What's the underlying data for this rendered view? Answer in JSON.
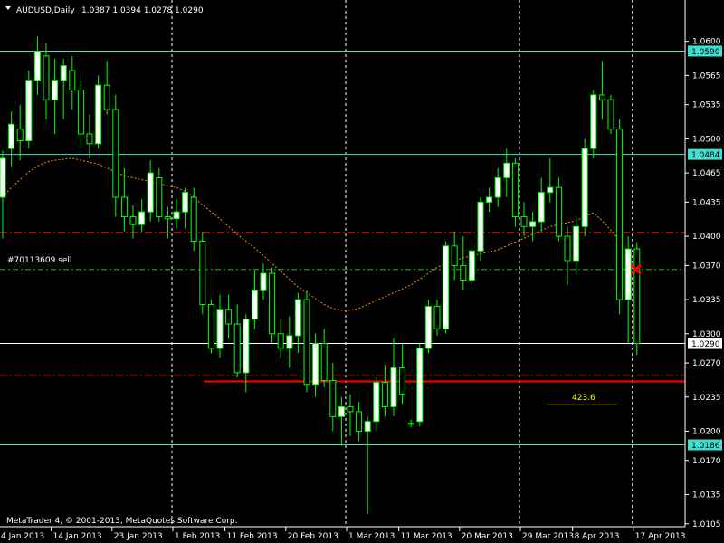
{
  "header": {
    "symbol": "AUDUSD,Daily",
    "ohlc": "1.0387 1.0394 1.0278 1.0290"
  },
  "order_label": "#70113609 sell",
  "fib_label": "423.6",
  "copyright": "MetaTrader 4, © 2001-2013, MetaQuotes Software Corp.",
  "colors": {
    "background": "#000000",
    "bull_candle": "#ffffff",
    "bear_candle": "#000000",
    "wick": "#00ff00",
    "hline": "#40e0d0",
    "support_line": "#ff0000",
    "ma_line": "#ff8c00",
    "fib_label": "#ffff00",
    "sell_marker": "#ff0000"
  },
  "chart_data": {
    "type": "candlestick",
    "title": "AUDUSD,Daily",
    "ylim": [
      1.0102,
      1.0622
    ],
    "y_ticks": [
      "1.0600",
      "1.0565",
      "1.0535",
      "1.0500",
      "1.0465",
      "1.0435",
      "1.0400",
      "1.0370",
      "1.0335",
      "1.0300",
      "1.0270",
      "1.0235",
      "1.0200",
      "1.0170",
      "1.0135",
      "1.0105"
    ],
    "x_ticks": [
      {
        "label": "4 Jan 2013",
        "index": 0
      },
      {
        "label": "14 Jan 2013",
        "index": 6
      },
      {
        "label": "23 Jan 2013",
        "index": 13
      },
      {
        "label": "1 Feb 2013",
        "index": 20
      },
      {
        "label": "11 Feb 2013",
        "index": 26
      },
      {
        "label": "20 Feb 2013",
        "index": 33
      },
      {
        "label": "1 Mar 2013",
        "index": 40
      },
      {
        "label": "11 Mar 2013",
        "index": 46
      },
      {
        "label": "20 Mar 2013",
        "index": 53
      },
      {
        "label": "29 Mar 2013",
        "index": 60
      },
      {
        "label": "8 Apr 2013",
        "index": 66
      },
      {
        "label": "17 Apr 2013",
        "index": 73
      }
    ],
    "candles": [
      {
        "date": "4 Jan 2013",
        "o": 1.044,
        "h": 1.0488,
        "l": 1.0398,
        "c": 1.048
      },
      {
        "date": "7 Jan 2013",
        "o": 1.049,
        "h": 1.0528,
        "l": 1.0472,
        "c": 1.0515
      },
      {
        "date": "8 Jan 2013",
        "o": 1.051,
        "h": 1.0535,
        "l": 1.0478,
        "c": 1.0498
      },
      {
        "date": "9 Jan 2013",
        "o": 1.0498,
        "h": 1.057,
        "l": 1.049,
        "c": 1.056
      },
      {
        "date": "10 Jan 2013",
        "o": 1.056,
        "h": 1.0605,
        "l": 1.0545,
        "c": 1.059
      },
      {
        "date": "11 Jan 2013",
        "o": 1.0585,
        "h": 1.0598,
        "l": 1.052,
        "c": 1.054
      },
      {
        "date": "14 Jan 2013",
        "o": 1.054,
        "h": 1.0582,
        "l": 1.0505,
        "c": 1.056
      },
      {
        "date": "15 Jan 2013",
        "o": 1.056,
        "h": 1.0582,
        "l": 1.052,
        "c": 1.0575
      },
      {
        "date": "16 Jan 2013",
        "o": 1.057,
        "h": 1.0585,
        "l": 1.053,
        "c": 1.055
      },
      {
        "date": "17 Jan 2013",
        "o": 1.055,
        "h": 1.056,
        "l": 1.049,
        "c": 1.0505
      },
      {
        "date": "18 Jan 2013",
        "o": 1.0505,
        "h": 1.0525,
        "l": 1.048,
        "c": 1.0495
      },
      {
        "date": "21 Jan 2013",
        "o": 1.0495,
        "h": 1.0565,
        "l": 1.049,
        "c": 1.0555
      },
      {
        "date": "22 Jan 2013",
        "o": 1.0555,
        "h": 1.058,
        "l": 1.0525,
        "c": 1.053
      },
      {
        "date": "23 Jan 2013",
        "o": 1.053,
        "h": 1.0545,
        "l": 1.042,
        "c": 1.044
      },
      {
        "date": "24 Jan 2013",
        "o": 1.044,
        "h": 1.047,
        "l": 1.0405,
        "c": 1.042
      },
      {
        "date": "25 Jan 2013",
        "o": 1.042,
        "h": 1.0432,
        "l": 1.0398,
        "c": 1.0412
      },
      {
        "date": "28 Jan 2013",
        "o": 1.0412,
        "h": 1.0438,
        "l": 1.0405,
        "c": 1.0425
      },
      {
        "date": "29 Jan 2013",
        "o": 1.0425,
        "h": 1.0478,
        "l": 1.0415,
        "c": 1.0465
      },
      {
        "date": "30 Jan 2013",
        "o": 1.046,
        "h": 1.047,
        "l": 1.0415,
        "c": 1.042
      },
      {
        "date": "31 Jan 2013",
        "o": 1.042,
        "h": 1.043,
        "l": 1.0398,
        "c": 1.0418
      },
      {
        "date": "1 Feb 2013",
        "o": 1.0418,
        "h": 1.0438,
        "l": 1.0408,
        "c": 1.0425
      },
      {
        "date": "4 Feb 2013",
        "o": 1.0425,
        "h": 1.045,
        "l": 1.0408,
        "c": 1.0445
      },
      {
        "date": "5 Feb 2013",
        "o": 1.044,
        "h": 1.045,
        "l": 1.0385,
        "c": 1.0395
      },
      {
        "date": "6 Feb 2013",
        "o": 1.0395,
        "h": 1.0405,
        "l": 1.032,
        "c": 1.033
      },
      {
        "date": "7 Feb 2013",
        "o": 1.033,
        "h": 1.0335,
        "l": 1.028,
        "c": 1.0285
      },
      {
        "date": "8 Feb 2013",
        "o": 1.0285,
        "h": 1.034,
        "l": 1.0275,
        "c": 1.0325
      },
      {
        "date": "11 Feb 2013",
        "o": 1.0325,
        "h": 1.034,
        "l": 1.0295,
        "c": 1.031
      },
      {
        "date": "12 Feb 2013",
        "o": 1.031,
        "h": 1.033,
        "l": 1.0255,
        "c": 1.026
      },
      {
        "date": "13 Feb 2013",
        "o": 1.026,
        "h": 1.032,
        "l": 1.024,
        "c": 1.0315
      },
      {
        "date": "14 Feb 2013",
        "o": 1.0315,
        "h": 1.0365,
        "l": 1.0305,
        "c": 1.0345
      },
      {
        "date": "15 Feb 2013",
        "o": 1.0345,
        "h": 1.0372,
        "l": 1.0335,
        "c": 1.0362
      },
      {
        "date": "18 Feb 2013",
        "o": 1.0362,
        "h": 1.0368,
        "l": 1.029,
        "c": 1.03
      },
      {
        "date": "19 Feb 2013",
        "o": 1.03,
        "h": 1.0315,
        "l": 1.0275,
        "c": 1.0285
      },
      {
        "date": "20 Feb 2013",
        "o": 1.0285,
        "h": 1.0318,
        "l": 1.0265,
        "c": 1.0298
      },
      {
        "date": "21 Feb 2013",
        "o": 1.0298,
        "h": 1.0342,
        "l": 1.028,
        "c": 1.0335
      },
      {
        "date": "22 Feb 2013",
        "o": 1.0335,
        "h": 1.0345,
        "l": 1.024,
        "c": 1.0248
      },
      {
        "date": "25 Feb 2013",
        "o": 1.0248,
        "h": 1.03,
        "l": 1.0235,
        "c": 1.029
      },
      {
        "date": "26 Feb 2013",
        "o": 1.029,
        "h": 1.0305,
        "l": 1.0245,
        "c": 1.0252
      },
      {
        "date": "27 Feb 2013",
        "o": 1.0252,
        "h": 1.027,
        "l": 1.02,
        "c": 1.0215
      },
      {
        "date": "28 Feb 2013",
        "o": 1.0215,
        "h": 1.0235,
        "l": 1.0185,
        "c": 1.0225
      },
      {
        "date": "1 Mar 2013",
        "o": 1.0225,
        "h": 1.0238,
        "l": 1.0195,
        "c": 1.022
      },
      {
        "date": "4 Mar 2013",
        "o": 1.022,
        "h": 1.023,
        "l": 1.019,
        "c": 1.02
      },
      {
        "date": "5 Mar 2013",
        "o": 1.02,
        "h": 1.0215,
        "l": 1.0115,
        "c": 1.021
      },
      {
        "date": "6 Mar 2013",
        "o": 1.021,
        "h": 1.0255,
        "l": 1.02,
        "c": 1.025
      },
      {
        "date": "7 Mar 2013",
        "o": 1.025,
        "h": 1.0268,
        "l": 1.0215,
        "c": 1.0225
      },
      {
        "date": "8 Mar 2013",
        "o": 1.0225,
        "h": 1.0295,
        "l": 1.0215,
        "c": 1.0265
      },
      {
        "date": "11 Mar 2013",
        "o": 1.0265,
        "h": 1.029,
        "l": 1.0228,
        "c": 1.0238
      },
      {
        "date": "12 Mar 2013",
        "o": 1.0208,
        "h": 1.0212,
        "l": 1.0204,
        "c": 1.0208
      },
      {
        "date": "13 Mar 2013",
        "o": 1.021,
        "h": 1.029,
        "l": 1.0205,
        "c": 1.0285
      },
      {
        "date": "14 Mar 2013",
        "o": 1.0285,
        "h": 1.0335,
        "l": 1.028,
        "c": 1.0328
      },
      {
        "date": "15 Mar 2013",
        "o": 1.0328,
        "h": 1.0335,
        "l": 1.0298,
        "c": 1.0305
      },
      {
        "date": "18 Mar 2013",
        "o": 1.0305,
        "h": 1.0395,
        "l": 1.03,
        "c": 1.039
      },
      {
        "date": "19 Mar 2013",
        "o": 1.039,
        "h": 1.0405,
        "l": 1.0355,
        "c": 1.037
      },
      {
        "date": "20 Mar 2013",
        "o": 1.037,
        "h": 1.04,
        "l": 1.0345,
        "c": 1.0355
      },
      {
        "date": "21 Mar 2013",
        "o": 1.0355,
        "h": 1.0388,
        "l": 1.035,
        "c": 1.0385
      },
      {
        "date": "22 Mar 2013",
        "o": 1.0385,
        "h": 1.044,
        "l": 1.0375,
        "c": 1.0435
      },
      {
        "date": "25 Mar 2013",
        "o": 1.0435,
        "h": 1.045,
        "l": 1.0425,
        "c": 1.044
      },
      {
        "date": "26 Mar 2013",
        "o": 1.044,
        "h": 1.047,
        "l": 1.043,
        "c": 1.046
      },
      {
        "date": "27 Mar 2013",
        "o": 1.046,
        "h": 1.049,
        "l": 1.044,
        "c": 1.0475
      },
      {
        "date": "28 Mar 2013",
        "o": 1.0475,
        "h": 1.048,
        "l": 1.041,
        "c": 1.042
      },
      {
        "date": "29 Mar 2013",
        "o": 1.042,
        "h": 1.0435,
        "l": 1.04,
        "c": 1.041
      },
      {
        "date": "1 Apr 2013",
        "o": 1.041,
        "h": 1.0425,
        "l": 1.0395,
        "c": 1.0415
      },
      {
        "date": "2 Apr 2013",
        "o": 1.0415,
        "h": 1.046,
        "l": 1.0405,
        "c": 1.0445
      },
      {
        "date": "3 Apr 2013",
        "o": 1.0445,
        "h": 1.048,
        "l": 1.0435,
        "c": 1.045
      },
      {
        "date": "4 Apr 2013",
        "o": 1.045,
        "h": 1.046,
        "l": 1.0395,
        "c": 1.04
      },
      {
        "date": "5 Apr 2013",
        "o": 1.04,
        "h": 1.041,
        "l": 1.035,
        "c": 1.0375
      },
      {
        "date": "8 Apr 2013",
        "o": 1.0375,
        "h": 1.042,
        "l": 1.036,
        "c": 1.041
      },
      {
        "date": "9 Apr 2013",
        "o": 1.041,
        "h": 1.05,
        "l": 1.04,
        "c": 1.049
      },
      {
        "date": "10 Apr 2013",
        "o": 1.049,
        "h": 1.055,
        "l": 1.048,
        "c": 1.0545
      },
      {
        "date": "11 Apr 2013",
        "o": 1.0545,
        "h": 1.058,
        "l": 1.052,
        "c": 1.054
      },
      {
        "date": "12 Apr 2013",
        "o": 1.054,
        "h": 1.0545,
        "l": 1.0505,
        "c": 1.051
      },
      {
        "date": "15 Apr 2013",
        "o": 1.051,
        "h": 1.052,
        "l": 1.032,
        "c": 1.0335
      },
      {
        "date": "16 Apr 2013",
        "o": 1.0335,
        "h": 1.04,
        "l": 1.029,
        "c": 1.0387
      },
      {
        "date": "17 Apr 2013",
        "o": 1.0387,
        "h": 1.0394,
        "l": 1.0278,
        "c": 1.029
      }
    ],
    "moving_average": [
      1.044,
      1.045,
      1.0458,
      1.0466,
      1.0472,
      1.0476,
      1.0478,
      1.0479,
      1.048,
      1.0478,
      1.0476,
      1.0474,
      1.047,
      1.0466,
      1.0462,
      1.046,
      1.0458,
      1.0456,
      1.0454,
      1.0452,
      1.045,
      1.0446,
      1.044,
      1.0432,
      1.0425,
      1.0418,
      1.041,
      1.0402,
      1.0395,
      1.0388,
      1.038,
      1.0372,
      1.0364,
      1.0356,
      1.0348,
      1.0342,
      1.0336,
      1.033,
      1.0326,
      1.0324,
      1.0324,
      1.0326,
      1.033,
      1.0334,
      1.0338,
      1.0342,
      1.0346,
      1.035,
      1.0356,
      1.0362,
      1.0368,
      1.0372,
      1.0375,
      1.0378,
      1.038,
      1.0382,
      1.0384,
      1.0386,
      1.039,
      1.0394,
      1.0398,
      1.0402,
      1.0406,
      1.041,
      1.0412,
      1.0414,
      1.0416,
      1.042,
      1.0424,
      1.0416,
      1.0406,
      1.0396
    ],
    "horizontal_lines": [
      {
        "price": 1.059,
        "label": "1.0590",
        "color": "#40e0d0",
        "style": "solid",
        "tag": "level-1.0590"
      },
      {
        "price": 1.0484,
        "label": "1.0484",
        "color": "#40e0d0",
        "style": "solid",
        "tag": "level-1.0484"
      },
      {
        "price": 1.029,
        "label": "1.0290",
        "color": "#ffffff",
        "style": "solid",
        "tag": "current-price"
      },
      {
        "price": 1.0186,
        "label": "1.0186",
        "color": "#40e0d0",
        "style": "solid",
        "tag": "level-1.0186"
      }
    ],
    "order_level": 1.0366,
    "dashed_levels": [
      1.0404,
      1.0257
    ],
    "support_level": 1.0251,
    "sell_marker": {
      "index": 73,
      "price": 1.0366
    }
  }
}
